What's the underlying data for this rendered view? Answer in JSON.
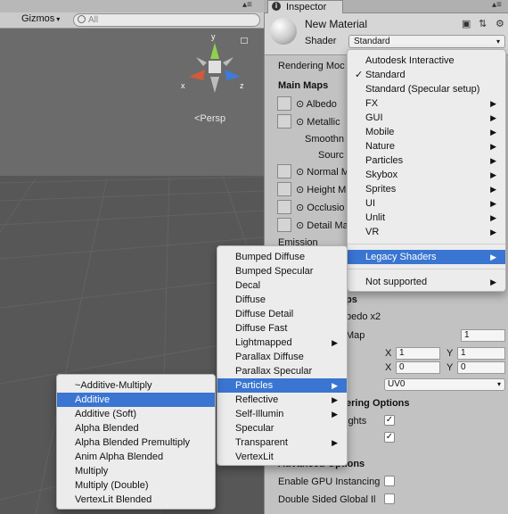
{
  "scene": {
    "gizmos_label": "Gizmos",
    "search_placeholder": "All",
    "persp_label": "<Persp",
    "axes": {
      "x": "x",
      "y": "y",
      "z": "z"
    }
  },
  "inspector": {
    "tab_label": "Inspector",
    "material_name": "New Material",
    "shader_label": "Shader",
    "shader_value": "Standard",
    "rendering_mode_label": "Rendering Moc",
    "main_maps_label": "Main Maps",
    "albedo": "Albedo",
    "metallic": "Metallic",
    "smoothness": "Smoothn",
    "source": "Sourc",
    "normal_map": "Normal M",
    "height_map": "Height M",
    "occlusion": "Occlusio",
    "detail_mask": "Detail Ma",
    "emission": "Emission",
    "secondary_maps": "ps",
    "detail_albedo": "bedo x2",
    "normal_map2": "Map",
    "normal_map2_value": "1",
    "tiling_x_label": "X",
    "tiling_x": "1",
    "tiling_y_label": "Y",
    "tiling_y": "1",
    "offset_x_label": "X",
    "offset_x": "0",
    "offset_y_label": "Y",
    "offset_y": "0",
    "uv_set": "UV0",
    "forward_options": "ering Options",
    "highlights": "ights",
    "advanced_options": "Advanced Options",
    "gpu_instancing": "Enable GPU Instancing",
    "double_sided": "Double Sided Global Il"
  },
  "shader_menu": {
    "items": [
      {
        "label": "Autodesk Interactive",
        "check": "",
        "sub": ""
      },
      {
        "label": "Standard",
        "check": "✓",
        "sub": ""
      },
      {
        "label": "Standard (Specular setup)",
        "check": "",
        "sub": ""
      },
      {
        "label": "FX",
        "check": "",
        "sub": "▶"
      },
      {
        "label": "GUI",
        "check": "",
        "sub": "▶"
      },
      {
        "label": "Mobile",
        "check": "",
        "sub": "▶"
      },
      {
        "label": "Nature",
        "check": "",
        "sub": "▶"
      },
      {
        "label": "Particles",
        "check": "",
        "sub": "▶"
      },
      {
        "label": "Skybox",
        "check": "",
        "sub": "▶"
      },
      {
        "label": "Sprites",
        "check": "",
        "sub": "▶"
      },
      {
        "label": "UI",
        "check": "",
        "sub": "▶"
      },
      {
        "label": "Unlit",
        "check": "",
        "sub": "▶"
      },
      {
        "label": "VR",
        "check": "",
        "sub": "▶"
      }
    ],
    "legacy": "Legacy Shaders",
    "legacy_sub": "▶",
    "not_supported": "Not supported",
    "not_supported_sub": "▶"
  },
  "legacy_menu": {
    "items": [
      {
        "label": "Bumped Diffuse",
        "sub": ""
      },
      {
        "label": "Bumped Specular",
        "sub": ""
      },
      {
        "label": "Decal",
        "sub": ""
      },
      {
        "label": "Diffuse",
        "sub": ""
      },
      {
        "label": "Diffuse Detail",
        "sub": ""
      },
      {
        "label": "Diffuse Fast",
        "sub": ""
      },
      {
        "label": "Lightmapped",
        "sub": "▶"
      },
      {
        "label": "Parallax Diffuse",
        "sub": ""
      },
      {
        "label": "Parallax Specular",
        "sub": ""
      },
      {
        "label": "Particles",
        "sub": "▶"
      },
      {
        "label": "Reflective",
        "sub": "▶"
      },
      {
        "label": "Self-Illumin",
        "sub": "▶"
      },
      {
        "label": "Specular",
        "sub": ""
      },
      {
        "label": "Transparent",
        "sub": "▶"
      },
      {
        "label": "VertexLit",
        "sub": ""
      }
    ]
  },
  "particles_menu": {
    "items": [
      {
        "label": "~Additive-Multiply"
      },
      {
        "label": "Additive"
      },
      {
        "label": "Additive (Soft)"
      },
      {
        "label": "Alpha Blended"
      },
      {
        "label": "Alpha Blended Premultiply"
      },
      {
        "label": "Anim Alpha Blended"
      },
      {
        "label": "Multiply"
      },
      {
        "label": "Multiply (Double)"
      },
      {
        "label": "VertexLit Blended"
      }
    ]
  },
  "colors": {
    "highlight": "#3a75d1",
    "menu_bg": "#ececec",
    "scene_bg": "#575757"
  }
}
